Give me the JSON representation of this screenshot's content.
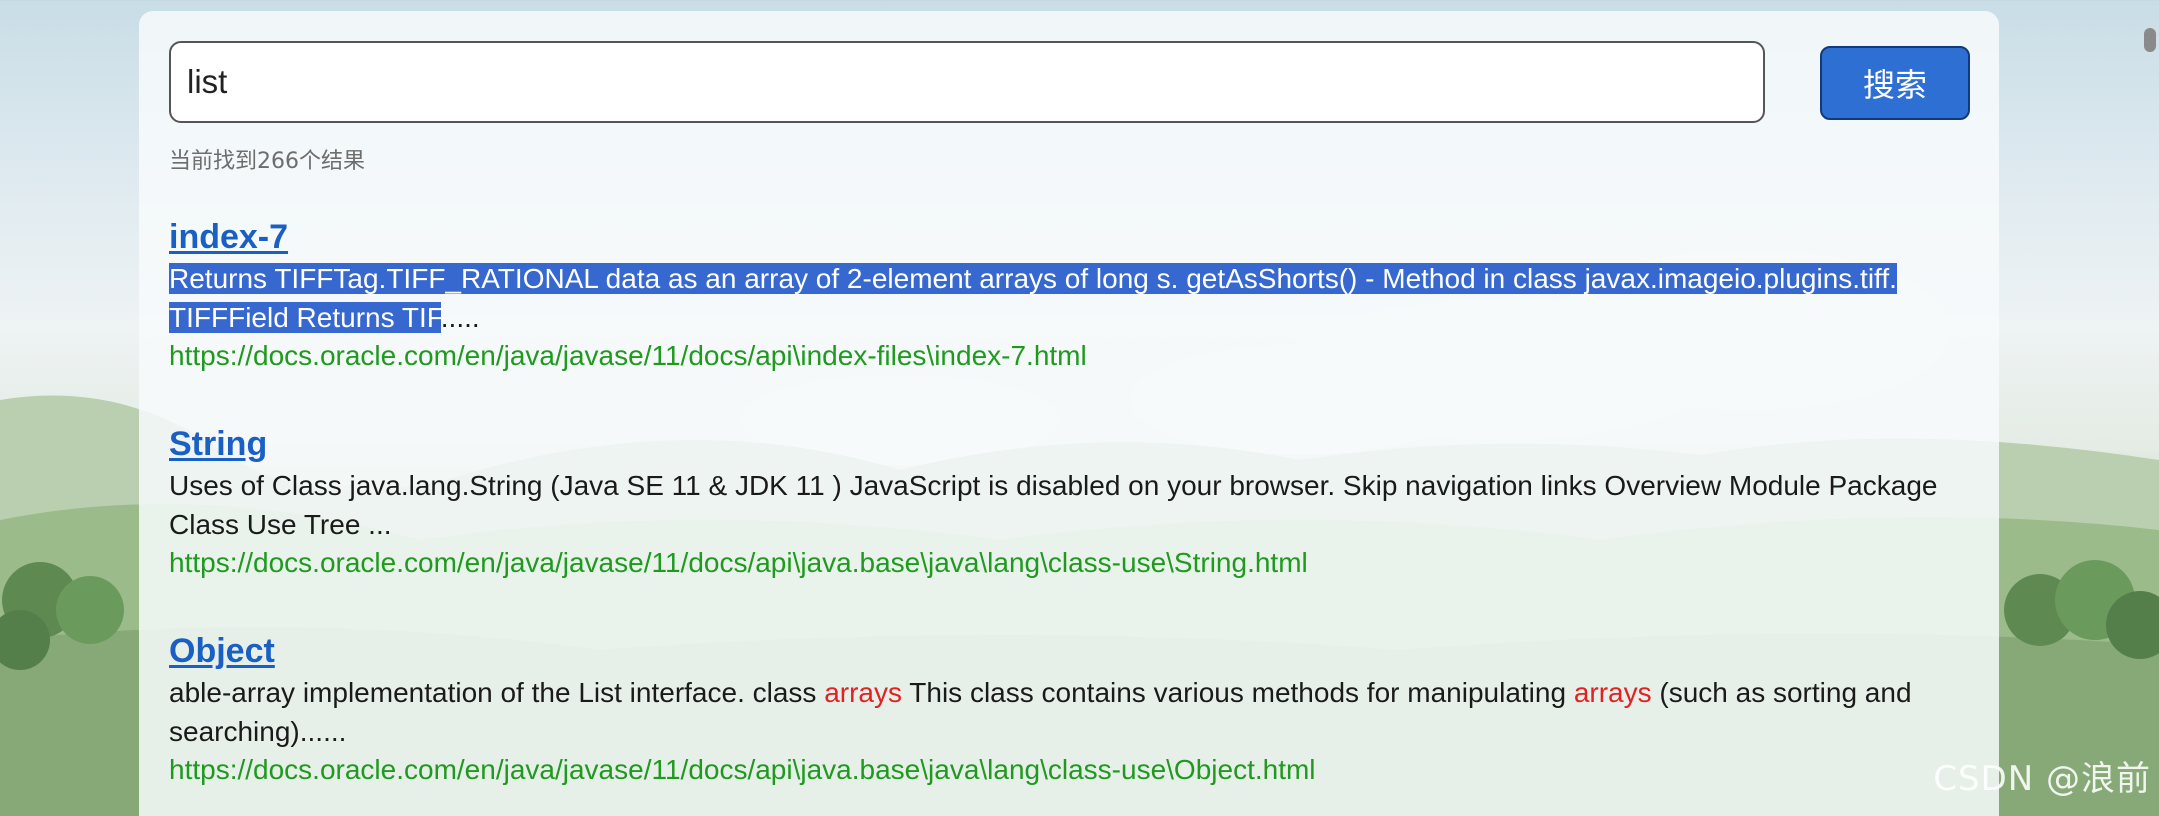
{
  "search": {
    "value": "list",
    "button_label": "搜索"
  },
  "result_count": "当前找到266个结果",
  "results": [
    {
      "title": "index-7",
      "snippet_selected": "Returns TIFFTag.TIFF_RATIONAL data as an array of 2-element arrays of long s. getAsShorts() - Method in class javax.imageio.plugins.tiff. TIFFField Returns TIF",
      "snippet_rest": ".....",
      "url": "https://docs.oracle.com/en/java/javase/11/docs/api\\index-files\\index-7.html"
    },
    {
      "title": "String",
      "snippet": "Uses of Class java.lang.String (Java SE 11 & JDK 11 ) JavaScript is disabled on your browser. Skip navigation links Overview Module Package Class Use Tree ...",
      "url": "https://docs.oracle.com/en/java/javase/11/docs/api\\java.base\\java\\lang\\class-use\\String.html"
    },
    {
      "title": "Object",
      "snippet_part1": "able-array implementation of the List interface. class ",
      "keyword1": "arrays",
      "snippet_part2": " This class contains various methods for manipulating ",
      "keyword2": "arrays",
      "snippet_part3": " (such as sorting and searching)......",
      "url": "https://docs.oracle.com/en/java/javase/11/docs/api\\java.base\\java\\lang\\class-use\\Object.html"
    }
  ],
  "watermark": "CSDN @浪前",
  "colors": {
    "link": "#1a5fc4",
    "url": "#1f9a1f",
    "keyword": "#e02222",
    "button": "#2e6fd4",
    "selection": "#3668cf"
  }
}
